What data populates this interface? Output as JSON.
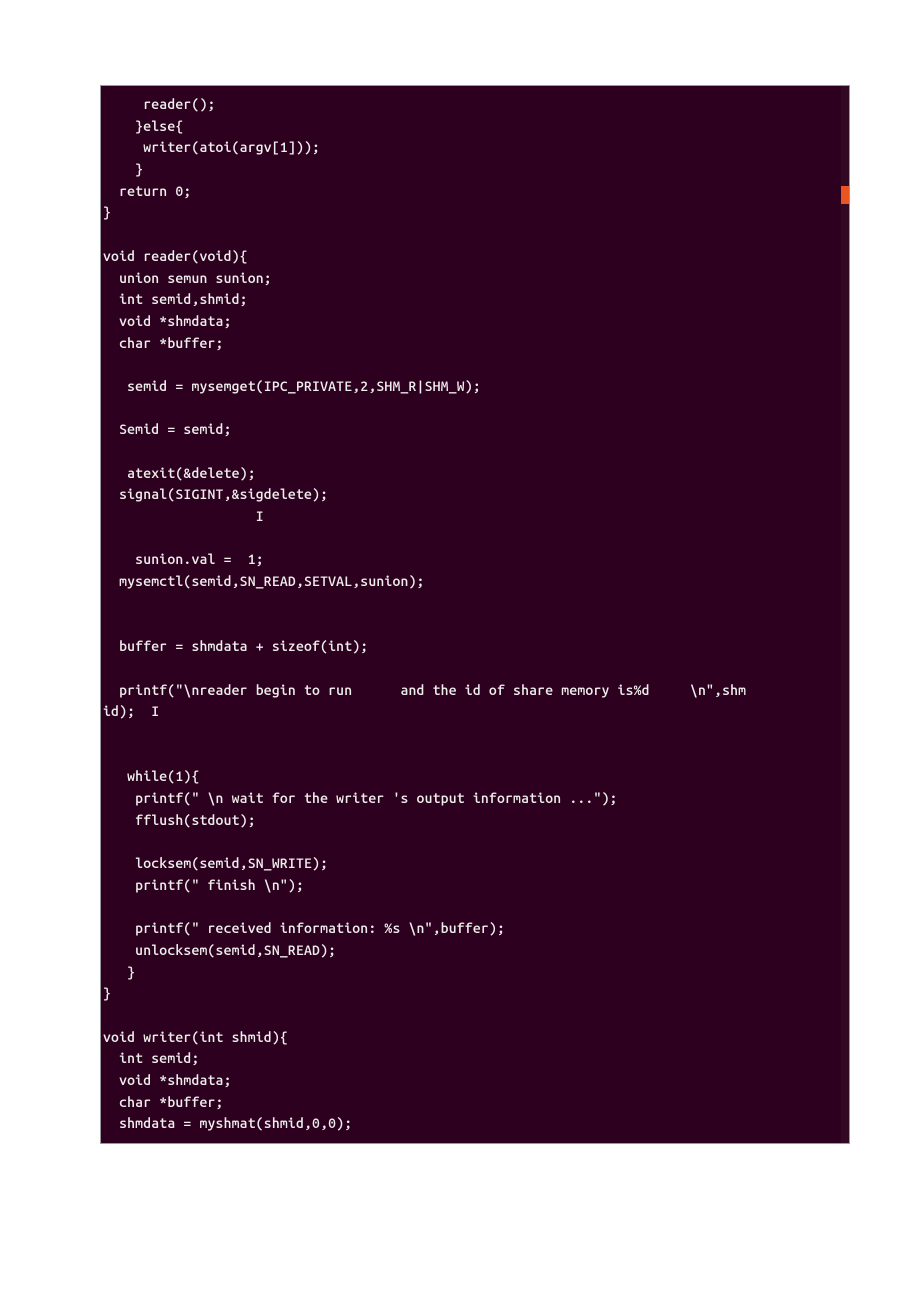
{
  "code": {
    "lines": [
      "     reader();",
      "    }else{",
      "     writer(atoi(argv[1]));",
      "    }",
      "  return 0;",
      "}",
      "",
      "void reader(void){",
      "  union semun sunion;",
      "  int semid,shmid;",
      "  void *shmdata;",
      "  char *buffer;",
      "",
      "   semid = mysemget(IPC_PRIVATE,2,SHM_R|SHM_W);",
      "",
      "  Semid = semid;",
      "",
      "   atexit(&delete);",
      "  signal(SIGINT,&sigdelete);",
      "                   I",
      "",
      "    sunion.val =  1;",
      "  mysemctl(semid,SN_READ,SETVAL,sunion);",
      "",
      "",
      "  buffer = shmdata + sizeof(int);",
      "",
      "  printf(\"\\nreader begin to run      and the id of share memory is%d     \\n\",shm",
      "id);  I",
      "",
      "",
      "   while(1){",
      "    printf(\" \\n wait for the writer 's output information ...\");",
      "    fflush(stdout);",
      "",
      "    locksem(semid,SN_WRITE);",
      "    printf(\" finish \\n\");",
      "",
      "    printf(\" received information: %s \\n\",buffer);",
      "    unlocksem(semid,SN_READ);",
      "   }",
      "}",
      "",
      "void writer(int shmid){",
      "  int semid;",
      "  void *shmdata;",
      "  char *buffer;",
      "  shmdata = myshmat(shmid,0,0);"
    ]
  },
  "colors": {
    "background": "#2c001e",
    "foreground": "#eeeeec",
    "scrollbar": "#e95420"
  }
}
